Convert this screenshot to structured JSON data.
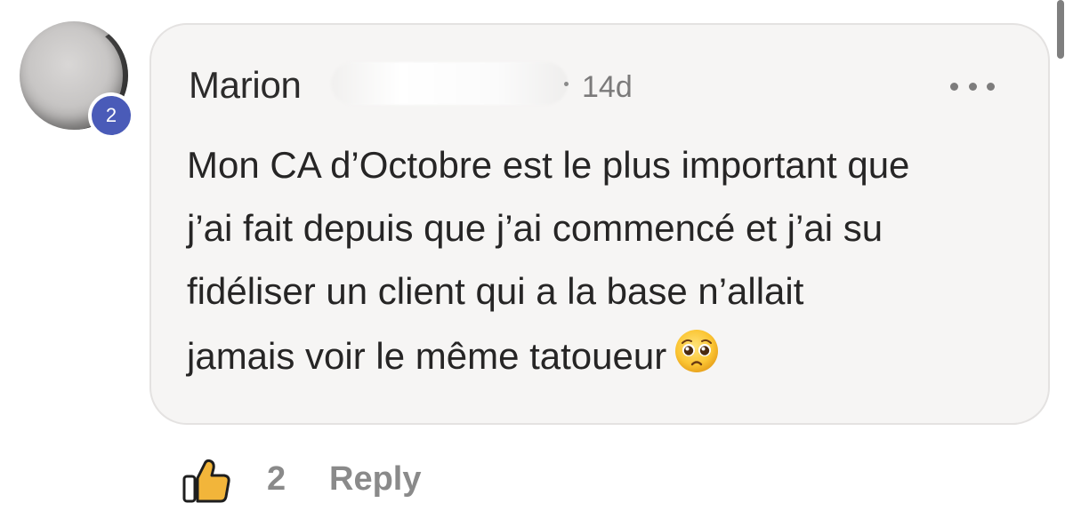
{
  "comment": {
    "author": "Marion",
    "avatar_badge": "2",
    "time_ago": "14d",
    "lines": [
      "Mon CA d’Octobre est le plus important que",
      "j’ai fait depuis que j’ai commencé et j’ai su",
      "fidéliser un client qui a la base n’allait",
      "jamais voir le même tatoueur"
    ],
    "emoji": "pleading-face-emoji"
  },
  "actions": {
    "like_icon": "thumbs-up-icon",
    "like_count": "2",
    "reply_label": "Reply"
  },
  "colors": {
    "badge": "#4a5bb8",
    "bubble_bg": "#f6f5f4",
    "muted_text": "#8a8a8a"
  }
}
